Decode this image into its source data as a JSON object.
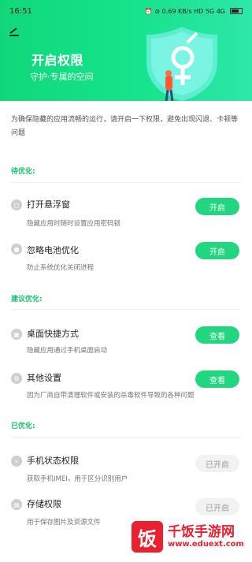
{
  "status": {
    "time": "16:51",
    "icons_text": "⏰ ⊘ 0.69 KB/s HD 5G 4G",
    "battery": "battery"
  },
  "header": {
    "title": "开启权限",
    "subtitle": "守护·专属的空间"
  },
  "intro": "为确保隐藏的应用流畅的运行，请开启一下权限，避免出现闪退、卡顿等问题",
  "sections": [
    {
      "label": "待优化:",
      "items": [
        {
          "title": "打开悬浮窗",
          "desc": "隐藏应用时随时设置应用密码锁",
          "button": "开启",
          "button_style": "green",
          "icon": "window-icon"
        },
        {
          "title": "忽略电池优化",
          "desc": "防止系统优化关闭进程",
          "button": "开启",
          "button_style": "green",
          "icon": "battery-icon"
        }
      ]
    },
    {
      "label": "建议优化:",
      "items": [
        {
          "title": "桌面快捷方式",
          "desc": "隐藏应用通过手机桌面启动",
          "button": "查看",
          "button_style": "green",
          "icon": "shortcut-icon"
        },
        {
          "title": "其他设置",
          "desc": "因为厂商自带清理软件或安装的杀毒软件导致的各种问题",
          "button": "查看",
          "button_style": "green",
          "icon": "settings-icon"
        }
      ]
    },
    {
      "label": "已优化:",
      "items": [
        {
          "title": "手机状态权限",
          "desc": "获取手机IMEI，用于区分识别用户",
          "button": "已开启",
          "button_style": "gray",
          "icon": "phone-icon"
        },
        {
          "title": "存储权限",
          "desc": "用于保存图片及资源文件",
          "button": "已开启",
          "button_style": "gray",
          "icon": "storage-icon"
        }
      ]
    }
  ],
  "watermark": {
    "logo": "饭",
    "main": "千饭手游网",
    "sub": "www.eduext.com"
  },
  "colors": {
    "accent": "#21d67e",
    "section": "#18c66e",
    "brand_red": "#e8202f"
  }
}
